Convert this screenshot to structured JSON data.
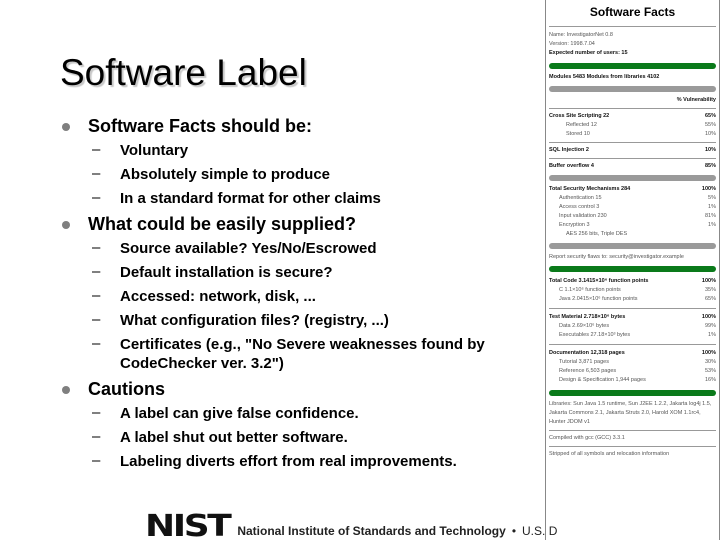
{
  "slide": {
    "title": "Software Label",
    "bullets": [
      {
        "text": "Software Facts should be:",
        "sub": [
          "Voluntary",
          "Absolutely simple to produce",
          "In a standard format for other claims"
        ]
      },
      {
        "text": "What could be easily supplied?",
        "sub": [
          "Source available? Yes/No/Escrowed",
          "Default installation is secure?",
          "Accessed: network, disk, ...",
          "What configuration files? (registry, ...)",
          "Certificates (e.g., \"No Severe weaknesses found by CodeChecker ver. 3.2\")"
        ]
      },
      {
        "text": "Cautions",
        "sub": [
          "A label can give false confidence.",
          "A label shut out better software.",
          "Labeling diverts effort from real improvements."
        ]
      }
    ]
  },
  "label": {
    "title": "Software Facts",
    "name": "Name: InvestigatorNet 0.8",
    "version": "Version: 1998.7.04",
    "expected_users": "Expected number of users: 15",
    "modules": "Modules 5483   Modules from libraries 4102",
    "vuln_header": "% Vulnerability",
    "vulns": [
      {
        "label": "Cross Site Scripting 22",
        "pct": "65%",
        "bold": true
      },
      {
        "label": "Reflected 12",
        "pct": "55%",
        "bold": false
      },
      {
        "label": "Stored 10",
        "pct": "10%",
        "bold": false
      },
      {
        "label": "SQL Injection 2",
        "pct": "10%",
        "bold": true
      },
      {
        "label": "Buffer overflow 4",
        "pct": "85%",
        "bold": true
      }
    ],
    "security_total": {
      "label": "Total Security Mechanisms 284",
      "pct": "100%"
    },
    "security": [
      {
        "label": "Authentication 15",
        "pct": "5%"
      },
      {
        "label": "Access control 3",
        "pct": "1%"
      },
      {
        "label": "Input validation 230",
        "pct": "81%"
      },
      {
        "label": "Encryption 3",
        "pct": "1%"
      }
    ],
    "encryption_detail": "AES 256 bits, Triple DES",
    "report_line": "Report security flaws to: security@investigator.example",
    "code_total": {
      "label": "Total Code 3.1415×10⁶ function points",
      "pct": "100%"
    },
    "code": [
      {
        "label": "C 1.1×10⁶ function points",
        "pct": "35%"
      },
      {
        "label": "Java 2.0415×10⁶ function points",
        "pct": "65%"
      }
    ],
    "test_total": {
      "label": "Test Material 2.718×10⁶ bytes",
      "pct": "100%"
    },
    "test": [
      {
        "label": "Data 2.69×10⁶ bytes",
        "pct": "99%"
      },
      {
        "label": "Executables 27.18×10³ bytes",
        "pct": "1%"
      }
    ],
    "docs_total": {
      "label": "Documentation 12,318 pages",
      "pct": "100%"
    },
    "docs": [
      {
        "label": "Tutorial 3,871 pages",
        "pct": "30%"
      },
      {
        "label": "Reference 6,503 pages",
        "pct": "53%"
      },
      {
        "label": "Design & Specification 1,944 pages",
        "pct": "16%"
      }
    ],
    "libraries": "Libraries: Sun Java 1.5 runtime, Sun J2EE 1.2.2, Jakarta log4j 1.5, Jakarta Commons 2.1, Jakarta Struts 2.0, Harold XOM 1.1rc4, Hunter JDOM v1",
    "compiled": "Compiled with gcc (GCC) 3.3.1",
    "stripped": "Stripped of all symbols and relocation information"
  },
  "footer": {
    "logo": "NIST",
    "institute": "National Institute of Standards and Technology",
    "separator": "•",
    "dept": "U.S. D"
  }
}
